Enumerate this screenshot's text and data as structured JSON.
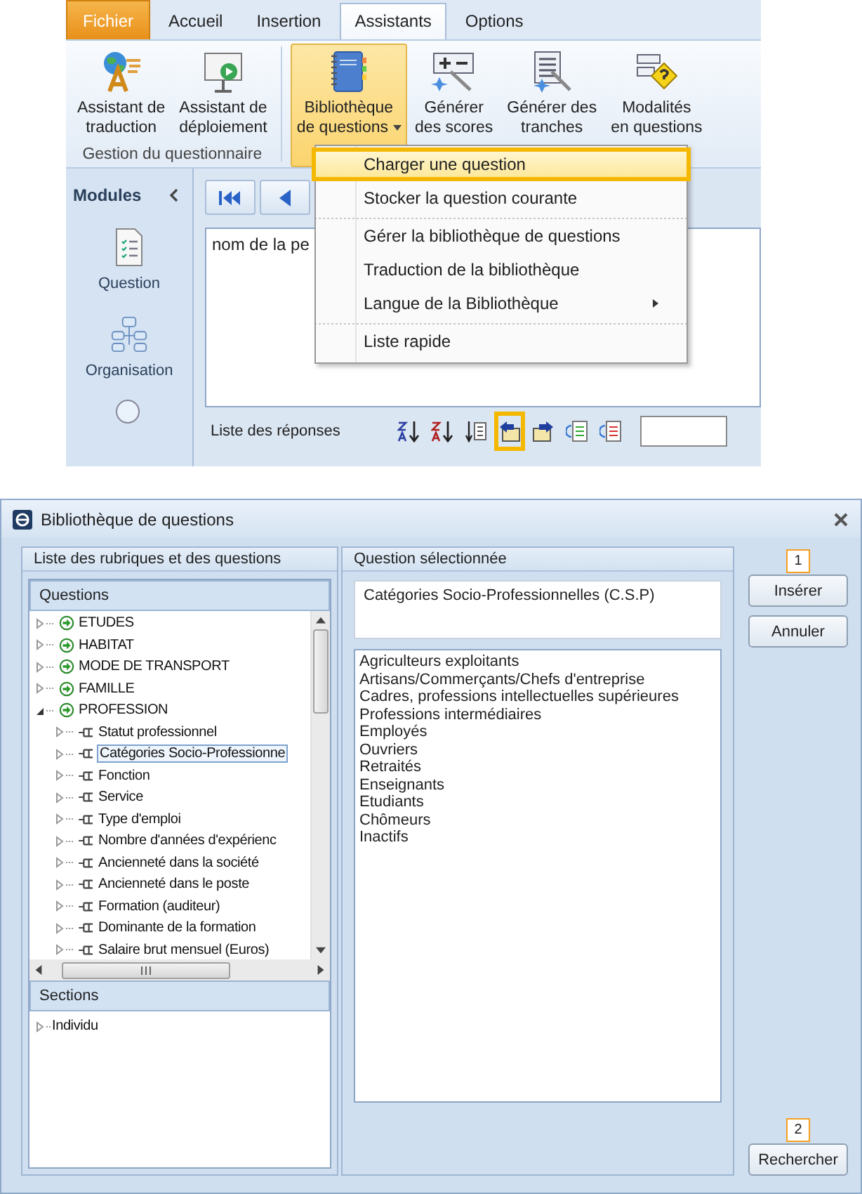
{
  "ribbon": {
    "tabs": [
      {
        "label": "Fichier",
        "kind": "file",
        "selected": false
      },
      {
        "label": "Accueil",
        "kind": "tab",
        "selected": false
      },
      {
        "label": "Insertion",
        "kind": "tab",
        "selected": false
      },
      {
        "label": "Assistants",
        "kind": "tab",
        "selected": true
      },
      {
        "label": "Options",
        "kind": "tab",
        "selected": false
      }
    ],
    "groups": [
      {
        "label": "Gestion du questionnaire",
        "buttons": [
          {
            "lines": [
              "Assistant de",
              "traduction"
            ],
            "pressed": false,
            "dropdown": false
          },
          {
            "lines": [
              "Assistant de",
              "déploiement"
            ],
            "pressed": false,
            "dropdown": false
          }
        ]
      },
      {
        "buttons": [
          {
            "lines": [
              "Bibliothèque",
              "de questions"
            ],
            "pressed": true,
            "dropdown": true
          },
          {
            "lines": [
              "Générer",
              "des scores"
            ],
            "pressed": false,
            "dropdown": false
          },
          {
            "lines": [
              "Générer des",
              "tranches"
            ],
            "pressed": false,
            "dropdown": false
          },
          {
            "lines": [
              "Modalités",
              "en questions"
            ],
            "pressed": false,
            "dropdown": false
          }
        ]
      }
    ]
  },
  "menu": {
    "items": [
      {
        "label": "Charger une question",
        "highlighted": true,
        "submenu": false,
        "separator_after": false
      },
      {
        "label": "Stocker la question courante",
        "highlighted": false,
        "submenu": false,
        "separator_after": true
      },
      {
        "label": "Gérer la bibliothèque de questions",
        "highlighted": false,
        "submenu": false,
        "separator_after": false
      },
      {
        "label": "Traduction de la bibliothèque",
        "highlighted": false,
        "submenu": false,
        "separator_after": false
      },
      {
        "label": "Langue de la Bibliothèque",
        "highlighted": false,
        "submenu": true,
        "separator_after": true
      },
      {
        "label": "Liste rapide",
        "highlighted": false,
        "submenu": false,
        "separator_after": false
      }
    ]
  },
  "modules": {
    "title": "Modules",
    "items": [
      {
        "label": "Question"
      },
      {
        "label": "Organisation"
      }
    ]
  },
  "editor": {
    "text": "nom de la pe"
  },
  "answers_toolbar": {
    "label": "Liste des réponses",
    "tools": [
      {
        "highlighted": false
      },
      {
        "highlighted": false
      },
      {
        "highlighted": false
      },
      {
        "highlighted": true
      },
      {
        "highlighted": false
      },
      {
        "highlighted": false
      },
      {
        "highlighted": false
      }
    ]
  },
  "dialog": {
    "title": "Bibliothèque de questions",
    "left_panel": {
      "title": "Liste des rubriques et des questions",
      "questions_header": "Questions",
      "questions": [
        {
          "label": "ETUDES",
          "expanded": false,
          "selected": false
        },
        {
          "label": "HABITAT",
          "expanded": false,
          "selected": false
        },
        {
          "label": "MODE DE TRANSPORT",
          "expanded": false,
          "selected": false
        },
        {
          "label": "FAMILLE",
          "expanded": false,
          "selected": false
        },
        {
          "label": "PROFESSION",
          "expanded": true,
          "selected": false,
          "children": [
            {
              "label": "Statut professionnel",
              "expanded": false,
              "selected": false
            },
            {
              "label": "Catégories Socio-Professionne",
              "expanded": false,
              "selected": true
            },
            {
              "label": "Fonction",
              "expanded": false,
              "selected": false
            },
            {
              "label": "Service",
              "expanded": false,
              "selected": false
            },
            {
              "label": "Type d'emploi",
              "expanded": false,
              "selected": false
            },
            {
              "label": "Nombre d'années d'expérienc",
              "expanded": false,
              "selected": false
            },
            {
              "label": "Ancienneté dans la société",
              "expanded": false,
              "selected": false
            },
            {
              "label": "Ancienneté dans le poste",
              "expanded": false,
              "selected": false
            },
            {
              "label": "Formation (auditeur)",
              "expanded": false,
              "selected": false
            },
            {
              "label": "Dominante de la formation",
              "expanded": false,
              "selected": false
            },
            {
              "label": "Salaire brut mensuel (Euros)",
              "expanded": false,
              "selected": false
            }
          ]
        }
      ],
      "sections_header": "Sections",
      "sections": [
        {
          "label": "Individu",
          "expanded": false,
          "selected": false
        }
      ]
    },
    "middle_panel": {
      "title": "Question sélectionnée",
      "question": "Catégories Socio-Professionnelles (C.S.P)",
      "answers": [
        "Agriculteurs exploitants",
        "Artisans/Commerçants/Chefs d'entreprise",
        "Cadres, professions intellectuelles supérieures",
        "Professions intermédiaires",
        "Employés",
        "Ouvriers",
        "Retraités",
        "Enseignants",
        "Etudiants",
        "Chômeurs",
        "Inactifs"
      ]
    },
    "actions": [
      {
        "label": "Insérer",
        "callout": "1"
      },
      {
        "label": "Annuler"
      }
    ],
    "bottom_action": {
      "label": "Rechercher",
      "callout": "2"
    }
  }
}
